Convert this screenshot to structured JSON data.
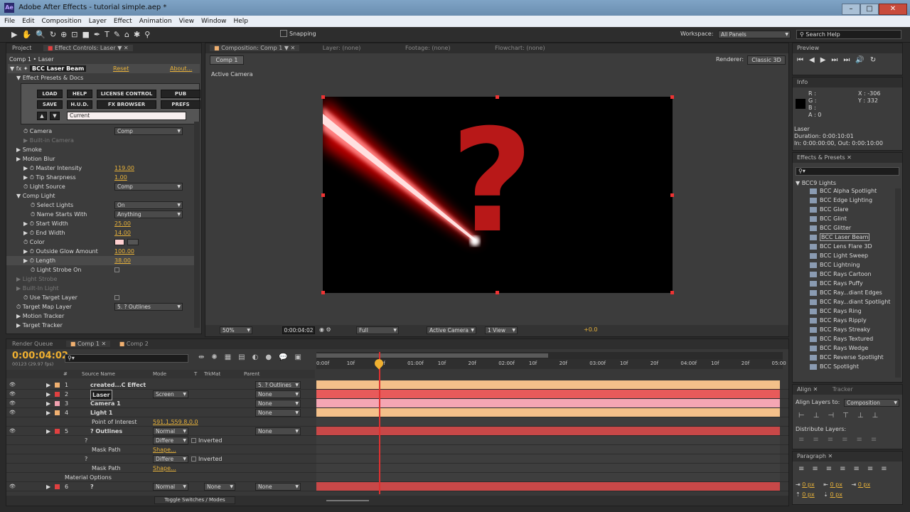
{
  "window": {
    "title": "Adobe After Effects - tutorial simple.aep *",
    "app_icon": "Ae"
  },
  "menu": [
    "File",
    "Edit",
    "Composition",
    "Layer",
    "Effect",
    "Animation",
    "View",
    "Window",
    "Help"
  ],
  "toolbar": {
    "snapping": "Snapping",
    "workspace_label": "Workspace:",
    "workspace_value": "All Panels",
    "search_help": "Search Help"
  },
  "left_panel": {
    "tabs": [
      "Project",
      "Effect Controls: Laser"
    ],
    "breadcrumb": "Comp 1 • Laser",
    "effect_name": "BCC Laser Beam",
    "reset": "Reset",
    "about": "About...",
    "presets": "Effect Presets & Docs",
    "buttons_row1": [
      "LOAD",
      "HELP",
      "LICENSE CONTROL",
      "PUB"
    ],
    "buttons_row2": [
      "SAVE",
      "H.U.D.",
      "FX BROWSER",
      "PREFS"
    ],
    "preset_current": "Current",
    "props": [
      {
        "label": "Camera",
        "value": "Comp",
        "type": "drop"
      },
      {
        "label": "Built-in Camera",
        "value": "",
        "type": "dim"
      },
      {
        "label": "Smoke",
        "value": "",
        "type": "group"
      },
      {
        "label": "Motion Blur",
        "value": "",
        "type": "group"
      },
      {
        "label": "Master Intensity",
        "value": "119.00",
        "type": "num"
      },
      {
        "label": "Tip Sharpness",
        "value": "1.00",
        "type": "num"
      },
      {
        "label": "Light Source",
        "value": "Comp",
        "type": "drop"
      },
      {
        "label": "Comp Light",
        "value": "",
        "type": "group"
      },
      {
        "label": "Select Lights",
        "value": "On",
        "type": "drop"
      },
      {
        "label": "Name Starts With",
        "value": "Anything",
        "type": "drop"
      },
      {
        "label": "Start Width",
        "value": "25.00",
        "type": "num"
      },
      {
        "label": "End Width",
        "value": "14.00",
        "type": "num"
      },
      {
        "label": "Color",
        "value": "",
        "type": "color"
      },
      {
        "label": "Outside Glow Amount",
        "value": "100.00",
        "type": "num"
      },
      {
        "label": "Length",
        "value": "38.00",
        "type": "num"
      },
      {
        "label": "Light Strobe On",
        "value": "",
        "type": "check"
      },
      {
        "label": "Light Strobe",
        "value": "",
        "type": "dim"
      },
      {
        "label": "Built-In Light",
        "value": "",
        "type": "dim"
      },
      {
        "label": "Use Target Layer",
        "value": "",
        "type": "check"
      },
      {
        "label": "Target Map Layer",
        "value": "5. ? Outlines",
        "type": "drop"
      },
      {
        "label": "Motion Tracker",
        "value": "",
        "type": "group"
      },
      {
        "label": "Target Tracker",
        "value": "",
        "type": "group"
      }
    ]
  },
  "comp_panel": {
    "tab": "Composition: Comp 1",
    "other_tabs": [
      "Layer: (none)",
      "Footage: (none)",
      "Flowchart: (none)"
    ],
    "comp_name": "Comp 1",
    "renderer_label": "Renderer:",
    "renderer_value": "Classic 3D",
    "active_camera": "Active Camera",
    "zoom": "50%",
    "timecode": "0:00:04:02",
    "resolution": "Full",
    "view_camera": "Active Camera",
    "view_count": "1 View",
    "exposure": "+0.0",
    "question_mark": "?"
  },
  "preview": {
    "title": "Preview"
  },
  "info": {
    "title": "Info",
    "channels": [
      "R :",
      "G :",
      "B :",
      "A : 0"
    ],
    "x": "X : -306",
    "y": "Y : 332",
    "layer": "Laser",
    "duration": "Duration: 0:00:10:01",
    "inout": "In: 0:00:00:00, Out: 0:00:10:00"
  },
  "effects_presets": {
    "title": "Effects & Presets",
    "group": "BCC9 Lights",
    "items": [
      "BCC Alpha Spotlight",
      "BCC Edge Lighting",
      "BCC Glare",
      "BCC Glint",
      "BCC Glitter",
      "BCC Laser Beam",
      "BCC Lens Flare 3D",
      "BCC Light Sweep",
      "BCC Lightning",
      "BCC Rays Cartoon",
      "BCC Rays Puffy",
      "BCC Ray...diant Edges",
      "BCC Ray...diant Spotlight",
      "BCC Rays Ring",
      "BCC Rays Ripply",
      "BCC Rays Streaky",
      "BCC Rays Textured",
      "BCC Rays Wedge",
      "BCC Reverse Spotlight",
      "BCC Spotlight"
    ],
    "selected_index": 5
  },
  "align": {
    "tabs": [
      "Align",
      "Tracker"
    ],
    "align_to_label": "Align Layers to:",
    "align_to_value": "Composition",
    "distribute": "Distribute Layers:"
  },
  "paragraph": {
    "title": "Paragraph",
    "px": [
      "0 px",
      "0 px",
      "0 px",
      "0 px",
      "0 px"
    ]
  },
  "timeline": {
    "tabs": [
      "Render Queue",
      "Comp 1",
      "Comp 2"
    ],
    "timecode": "0:00:04:02",
    "fps": "00123 (29.97 fps)",
    "col_headers": [
      "#",
      "Source Name",
      "Mode",
      "T",
      "TrkMat",
      "Parent"
    ],
    "ruler": [
      "0:00f",
      "10f",
      "20f",
      "01:00f",
      "10f",
      "20f",
      "02:00f",
      "10f",
      "20f",
      "03:00f",
      "10f",
      "20f",
      "04:00f",
      "10f",
      "20f",
      "05:00"
    ],
    "layers": [
      {
        "num": "1",
        "name": "created...C Effect",
        "mode": "",
        "trkmat": "",
        "parent": "5. ? Outlines",
        "color": "#f0b070",
        "bar": "#f4c08a"
      },
      {
        "num": "2",
        "name": "Laser",
        "mode": "Screen",
        "trkmat": "",
        "parent": "None",
        "color": "#e04040",
        "bar": "#e85a5a"
      },
      {
        "num": "3",
        "name": "Camera 1",
        "mode": "",
        "trkmat": "",
        "parent": "None",
        "color": "#f0a0b0",
        "bar": "#f5a6b4"
      },
      {
        "num": "4",
        "name": "Light 1",
        "mode": "",
        "trkmat": "",
        "parent": "None",
        "color": "#f0b070",
        "bar": "#f4c08a"
      },
      {
        "num": "",
        "name": "Point of Interest",
        "value": "591.1,559.8,0.0"
      },
      {
        "num": "5",
        "name": "? Outlines",
        "mode": "Normal",
        "trkmat": "",
        "parent": "None",
        "color": "#e04040",
        "bar": "#c84848"
      },
      {
        "num": "",
        "name": "?",
        "mode": "Differe",
        "inverted": "Inverted"
      },
      {
        "num": "",
        "name": "Mask Path",
        "value": "Shape..."
      },
      {
        "num": "",
        "name": "?",
        "mode": "Differe",
        "inverted": "Inverted"
      },
      {
        "num": "",
        "name": "Mask Path",
        "value": "Shape..."
      },
      {
        "num": "",
        "name": "Material Options"
      },
      {
        "num": "6",
        "name": "?",
        "mode": "Normal",
        "trkmat": "None",
        "parent": "None",
        "color": "#e04040",
        "bar": "#c84848"
      }
    ],
    "toggle": "Toggle Switches / Modes"
  }
}
